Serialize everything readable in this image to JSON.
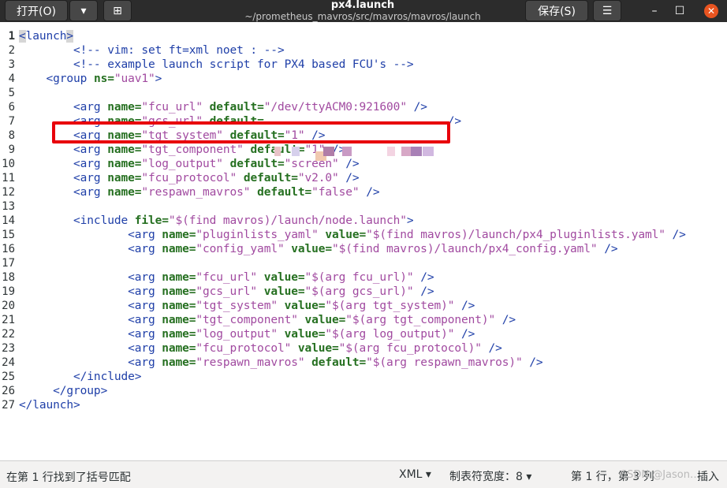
{
  "header": {
    "open_label": "打开(O)",
    "open_arrow": "▾",
    "new_tab_icon": "⊞",
    "title": "px4.launch",
    "subtitle": "~/prometheus_mavros/src/mavros/mavros/launch",
    "save_label": "保存(S)",
    "menu_icon": "☰",
    "minimize_icon": "–",
    "maximize_icon": "☐",
    "close_icon": "✕",
    "close_color": "#e95420"
  },
  "editor": {
    "line_numbers": [
      "1",
      "2",
      "3",
      "4",
      "5",
      "6",
      "7",
      "8",
      "9",
      "10",
      "11",
      "12",
      "13",
      "14",
      "15",
      "16",
      "17",
      "18",
      "19",
      "20",
      "21",
      "22",
      "23",
      "24",
      "25",
      "26",
      "27"
    ],
    "current_line": "1",
    "colors": {
      "tag": "#1f3fa8",
      "attribute": "#267021",
      "string": "#a14aa0",
      "highlight_box": "#e8000b"
    },
    "lines": [
      [
        [
          "br",
          "<"
        ],
        [
          "tag",
          "launch"
        ],
        [
          "br",
          ">"
        ]
      ],
      [
        [
          "plain",
          "\t"
        ],
        [
          "cmt",
          "<!-- vim: set ft=xml noet : -->"
        ]
      ],
      [
        [
          "plain",
          "\t"
        ],
        [
          "cmt",
          "<!-- example launch script for PX4 based FCU's -->"
        ]
      ],
      [
        [
          "plain",
          "    "
        ],
        [
          "tag",
          "<group "
        ],
        [
          "attr",
          "ns="
        ],
        [
          "str",
          "\"uav1\""
        ],
        [
          "tag",
          ">"
        ]
      ],
      [],
      [
        [
          "plain",
          "\t"
        ],
        [
          "tag",
          "<arg "
        ],
        [
          "attr",
          "name="
        ],
        [
          "str",
          "\"fcu_url\""
        ],
        [
          "plain",
          " "
        ],
        [
          "attr",
          "default="
        ],
        [
          "str",
          "\"/dev/ttyACM0:921600\""
        ],
        [
          "plain",
          " "
        ],
        [
          "tag",
          "/>"
        ]
      ],
      [
        [
          "plain",
          "\t"
        ],
        [
          "tag",
          "<arg "
        ],
        [
          "attr",
          "name="
        ],
        [
          "str",
          "\"gcs_url\""
        ],
        [
          "plain",
          " "
        ],
        [
          "attr",
          "default="
        ],
        [
          "plain",
          "                           "
        ],
        [
          "tag",
          "/>"
        ]
      ],
      [
        [
          "plain",
          "\t"
        ],
        [
          "tag",
          "<arg "
        ],
        [
          "attr",
          "name="
        ],
        [
          "str",
          "\"tgt_system\""
        ],
        [
          "plain",
          " "
        ],
        [
          "attr",
          "default="
        ],
        [
          "str",
          "\"1\""
        ],
        [
          "plain",
          " "
        ],
        [
          "tag",
          "/>"
        ]
      ],
      [
        [
          "plain",
          "\t"
        ],
        [
          "tag",
          "<arg "
        ],
        [
          "attr",
          "name="
        ],
        [
          "str",
          "\"tgt_component\""
        ],
        [
          "plain",
          " "
        ],
        [
          "attr",
          "default="
        ],
        [
          "str",
          "\"1\""
        ],
        [
          "plain",
          " "
        ],
        [
          "tag",
          "/>"
        ]
      ],
      [
        [
          "plain",
          "\t"
        ],
        [
          "tag",
          "<arg "
        ],
        [
          "attr",
          "name="
        ],
        [
          "str",
          "\"log_output\""
        ],
        [
          "plain",
          " "
        ],
        [
          "attr",
          "default="
        ],
        [
          "str",
          "\"screen\""
        ],
        [
          "plain",
          " "
        ],
        [
          "tag",
          "/>"
        ]
      ],
      [
        [
          "plain",
          "\t"
        ],
        [
          "tag",
          "<arg "
        ],
        [
          "attr",
          "name="
        ],
        [
          "str",
          "\"fcu_protocol\""
        ],
        [
          "plain",
          " "
        ],
        [
          "attr",
          "default="
        ],
        [
          "str",
          "\"v2.0\""
        ],
        [
          "plain",
          " "
        ],
        [
          "tag",
          "/>"
        ]
      ],
      [
        [
          "plain",
          "\t"
        ],
        [
          "tag",
          "<arg "
        ],
        [
          "attr",
          "name="
        ],
        [
          "str",
          "\"respawn_mavros\""
        ],
        [
          "plain",
          " "
        ],
        [
          "attr",
          "default="
        ],
        [
          "str",
          "\"false\""
        ],
        [
          "plain",
          " "
        ],
        [
          "tag",
          "/>"
        ]
      ],
      [],
      [
        [
          "plain",
          "\t"
        ],
        [
          "tag",
          "<include "
        ],
        [
          "attr",
          "file="
        ],
        [
          "str",
          "\"$(find mavros)/launch/node.launch\""
        ],
        [
          "tag",
          ">"
        ]
      ],
      [
        [
          "plain",
          "\t\t"
        ],
        [
          "tag",
          "<arg "
        ],
        [
          "attr",
          "name="
        ],
        [
          "str",
          "\"pluginlists_yaml\""
        ],
        [
          "plain",
          " "
        ],
        [
          "attr",
          "value="
        ],
        [
          "str",
          "\"$(find mavros)/launch/px4_pluginlists.yaml\""
        ],
        [
          "plain",
          " "
        ],
        [
          "tag",
          "/>"
        ]
      ],
      [
        [
          "plain",
          "\t\t"
        ],
        [
          "tag",
          "<arg "
        ],
        [
          "attr",
          "name="
        ],
        [
          "str",
          "\"config_yaml\""
        ],
        [
          "plain",
          " "
        ],
        [
          "attr",
          "value="
        ],
        [
          "str",
          "\"$(find mavros)/launch/px4_config.yaml\""
        ],
        [
          "plain",
          " "
        ],
        [
          "tag",
          "/>"
        ]
      ],
      [],
      [
        [
          "plain",
          "\t\t"
        ],
        [
          "tag",
          "<arg "
        ],
        [
          "attr",
          "name="
        ],
        [
          "str",
          "\"fcu_url\""
        ],
        [
          "plain",
          " "
        ],
        [
          "attr",
          "value="
        ],
        [
          "str",
          "\"$(arg fcu_url)\""
        ],
        [
          "plain",
          " "
        ],
        [
          "tag",
          "/>"
        ]
      ],
      [
        [
          "plain",
          "\t\t"
        ],
        [
          "tag",
          "<arg "
        ],
        [
          "attr",
          "name="
        ],
        [
          "str",
          "\"gcs_url\""
        ],
        [
          "plain",
          " "
        ],
        [
          "attr",
          "value="
        ],
        [
          "str",
          "\"$(arg gcs_url)\""
        ],
        [
          "plain",
          " "
        ],
        [
          "tag",
          "/>"
        ]
      ],
      [
        [
          "plain",
          "\t\t"
        ],
        [
          "tag",
          "<arg "
        ],
        [
          "attr",
          "name="
        ],
        [
          "str",
          "\"tgt_system\""
        ],
        [
          "plain",
          " "
        ],
        [
          "attr",
          "value="
        ],
        [
          "str",
          "\"$(arg tgt_system)\""
        ],
        [
          "plain",
          " "
        ],
        [
          "tag",
          "/>"
        ]
      ],
      [
        [
          "plain",
          "\t\t"
        ],
        [
          "tag",
          "<arg "
        ],
        [
          "attr",
          "name="
        ],
        [
          "str",
          "\"tgt_component\""
        ],
        [
          "plain",
          " "
        ],
        [
          "attr",
          "value="
        ],
        [
          "str",
          "\"$(arg tgt_component)\""
        ],
        [
          "plain",
          " "
        ],
        [
          "tag",
          "/>"
        ]
      ],
      [
        [
          "plain",
          "\t\t"
        ],
        [
          "tag",
          "<arg "
        ],
        [
          "attr",
          "name="
        ],
        [
          "str",
          "\"log_output\""
        ],
        [
          "plain",
          " "
        ],
        [
          "attr",
          "value="
        ],
        [
          "str",
          "\"$(arg log_output)\""
        ],
        [
          "plain",
          " "
        ],
        [
          "tag",
          "/>"
        ]
      ],
      [
        [
          "plain",
          "\t\t"
        ],
        [
          "tag",
          "<arg "
        ],
        [
          "attr",
          "name="
        ],
        [
          "str",
          "\"fcu_protocol\""
        ],
        [
          "plain",
          " "
        ],
        [
          "attr",
          "value="
        ],
        [
          "str",
          "\"$(arg fcu_protocol)\""
        ],
        [
          "plain",
          " "
        ],
        [
          "tag",
          "/>"
        ]
      ],
      [
        [
          "plain",
          "\t\t"
        ],
        [
          "tag",
          "<arg "
        ],
        [
          "attr",
          "name="
        ],
        [
          "str",
          "\"respawn_mavros\""
        ],
        [
          "plain",
          " "
        ],
        [
          "attr",
          "default="
        ],
        [
          "str",
          "\"$(arg respawn_mavros)\""
        ],
        [
          "plain",
          " "
        ],
        [
          "tag",
          "/>"
        ]
      ],
      [
        [
          "plain",
          "\t"
        ],
        [
          "tag",
          "</include>"
        ]
      ],
      [
        [
          "plain",
          "     "
        ],
        [
          "tag",
          "</group>"
        ]
      ],
      [
        [
          "tag",
          "</launch>"
        ]
      ]
    ]
  },
  "statusbar": {
    "message": "在第 1 行找到了括号匹配",
    "language": "XML ▾",
    "tab_width": "制表符宽度：8 ▾",
    "position": "第 1 行，第 3 列",
    "mode": "插入",
    "watermark": "CSDN @Jason…"
  }
}
